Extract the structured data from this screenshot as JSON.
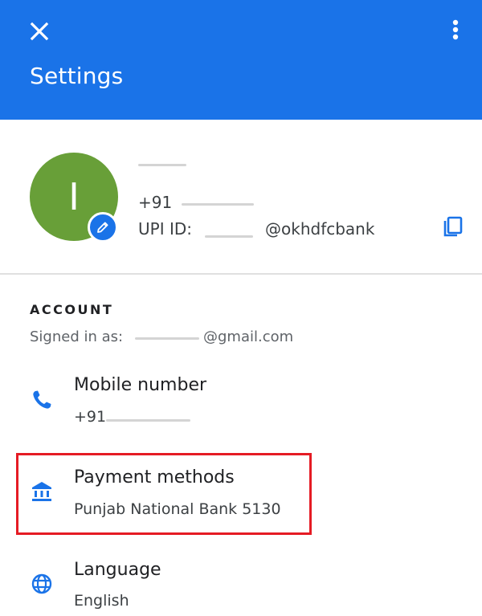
{
  "colors": {
    "appbar": "#1a73e8",
    "avatar": "#689f38",
    "highlight": "#e51b24",
    "icon_blue": "#1a73e8"
  },
  "appbar": {
    "title": "Settings",
    "close_icon": "close-icon",
    "more_icon": "more-vert-icon"
  },
  "profile": {
    "avatar_initial": "I",
    "phone_prefix": "+91",
    "upi_label": "UPI ID:",
    "upi_suffix": "@okhdfcbank",
    "copy_icon": "copy-icon",
    "edit_icon": "pencil-icon"
  },
  "account": {
    "section_title": "ACCOUNT",
    "signed_in_label": "Signed in as:",
    "signed_in_email_suffix": "@gmail.com"
  },
  "items": [
    {
      "title": "Mobile number",
      "subtitle": "+91",
      "icon": "phone-icon"
    },
    {
      "title": "Payment methods",
      "subtitle": "Punjab National Bank 5130",
      "icon": "bank-icon"
    },
    {
      "title": "Language",
      "subtitle": "English",
      "icon": "globe-icon"
    }
  ]
}
